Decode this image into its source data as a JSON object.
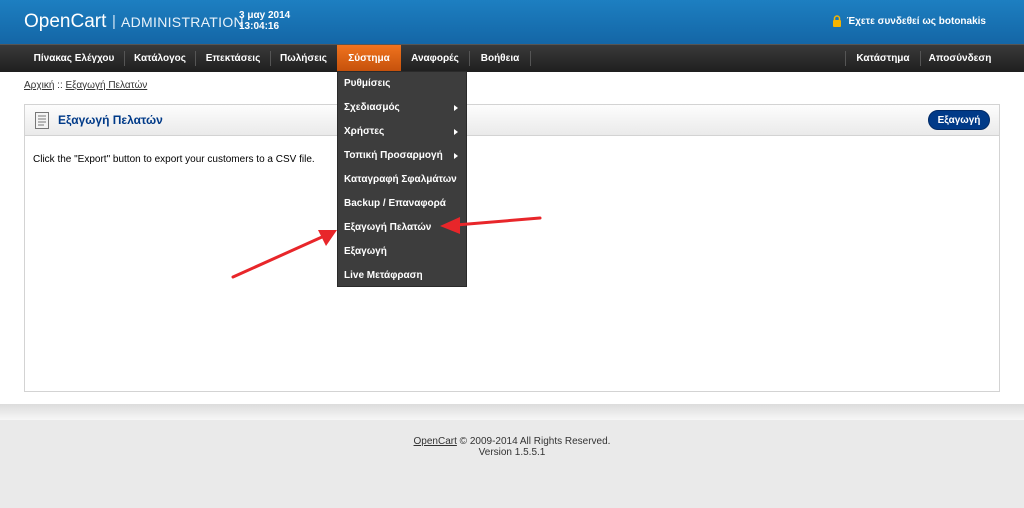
{
  "header": {
    "logo": "OpenCart",
    "separator": "|",
    "admin_label": "ADMINISTRATION",
    "date_line1": "3 μαy 2014",
    "date_line2": "13:04:16",
    "login_text": "Έχετε συνδεθεί ως botonakis",
    "lock_icon": "lock-icon",
    "color": "#1870b3"
  },
  "menu": {
    "items": [
      {
        "label": "Πίνακας Ελέγχου"
      },
      {
        "label": "Κατάλογος"
      },
      {
        "label": "Επεκτάσεις"
      },
      {
        "label": "Πωλήσεις"
      },
      {
        "label": "Σύστημα"
      },
      {
        "label": "Αναφορές"
      },
      {
        "label": "Βοήθεια"
      }
    ],
    "right_items": [
      {
        "label": "Κατάστημα"
      },
      {
        "label": "Αποσύνδεση"
      }
    ],
    "active": "Σύστημα",
    "active_color": "#e0651a"
  },
  "dropdown": {
    "items": [
      {
        "label": "Ρυθμίσεις",
        "submenu": false
      },
      {
        "label": "Σχεδιασμός",
        "submenu": true
      },
      {
        "label": "Χρήστες",
        "submenu": true
      },
      {
        "label": "Τοπική Προσαρμογή",
        "submenu": true
      },
      {
        "label": "Καταγραφή Σφαλμάτων",
        "submenu": false
      },
      {
        "label": "Backup / Επαναφορά",
        "submenu": false
      },
      {
        "label": "Εξαγωγή Πελατών",
        "submenu": false
      },
      {
        "label": "Εξαγωγή",
        "submenu": false
      },
      {
        "label": "Live Μετάφραση",
        "submenu": false
      }
    ]
  },
  "breadcrumb": {
    "home": "Αρχική",
    "separator": "::",
    "current": "Εξαγωγή Πελατών"
  },
  "box": {
    "title": "Εξαγωγή Πελατών",
    "icon": "document-icon",
    "export_button": "Εξαγωγή",
    "description": "Click the \"Export\" button to export your customers to a CSV file."
  },
  "footer": {
    "link": "OpenCart",
    "copyright": "© 2009-2014 All Rights Reserved.",
    "version": "Version 1.5.5.1"
  },
  "annotations": {
    "arrow_color": "#e8262a"
  }
}
